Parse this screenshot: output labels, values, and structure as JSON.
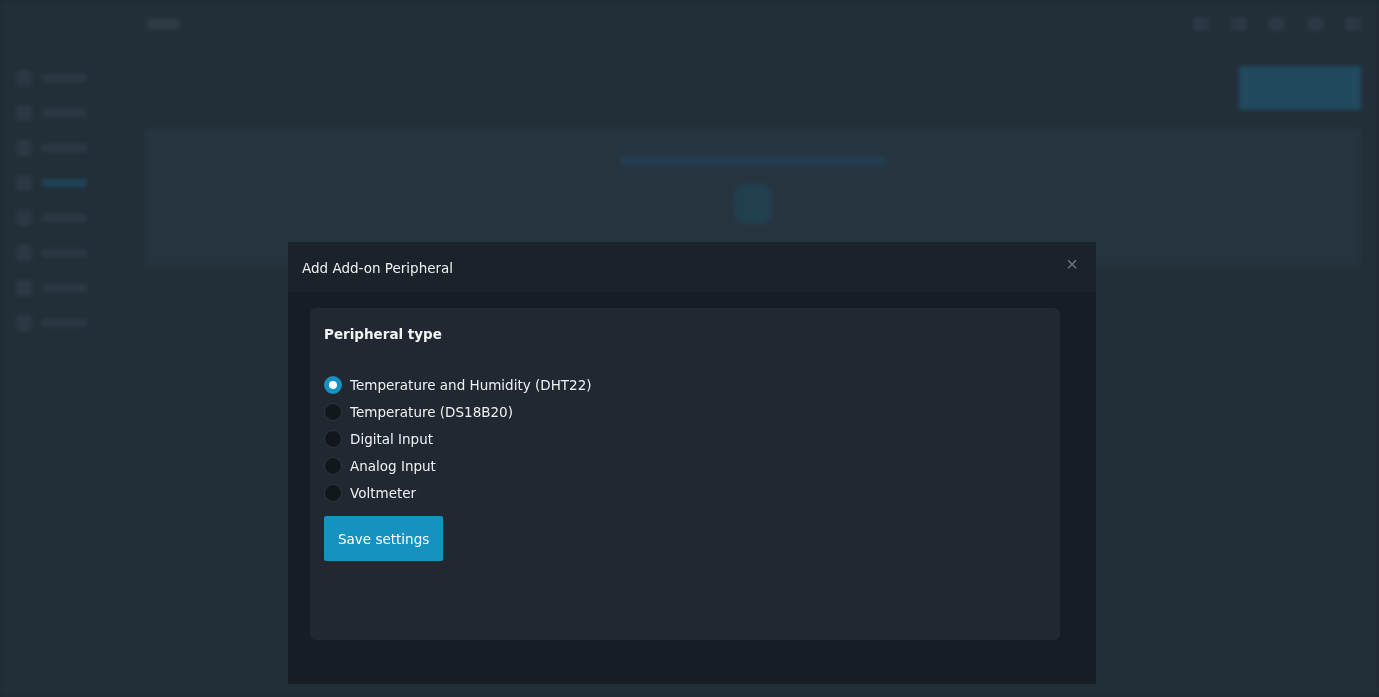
{
  "dialog": {
    "title": "Add Add-on Peripheral",
    "close": "×",
    "section_title": "Peripheral type",
    "options": [
      {
        "label": "Temperature and Humidity (DHT22)",
        "selected": true
      },
      {
        "label": "Temperature (DS18B20)",
        "selected": false
      },
      {
        "label": "Digital Input",
        "selected": false
      },
      {
        "label": "Analog Input",
        "selected": false
      },
      {
        "label": "Voltmeter",
        "selected": false
      }
    ],
    "save_button": "Save settings"
  }
}
